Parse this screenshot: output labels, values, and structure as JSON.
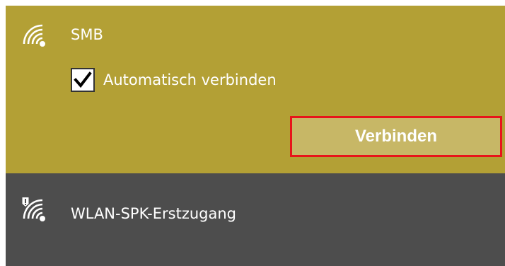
{
  "colors": {
    "selected_bg": "#b3a035",
    "other_bg": "#4d4d4d",
    "button_bg": "#c7b766",
    "highlight": "#e8141a",
    "text": "#ffffff"
  },
  "networks": [
    {
      "name": "SMB",
      "icon": "wifi-icon",
      "selected": true,
      "auto_connect_label": "Automatisch verbinden",
      "auto_connect_checked": true,
      "connect_label": "Verbinden"
    },
    {
      "name": "WLAN-SPK-Erstzugang",
      "icon": "wifi-unsecured-icon",
      "selected": false
    }
  ]
}
